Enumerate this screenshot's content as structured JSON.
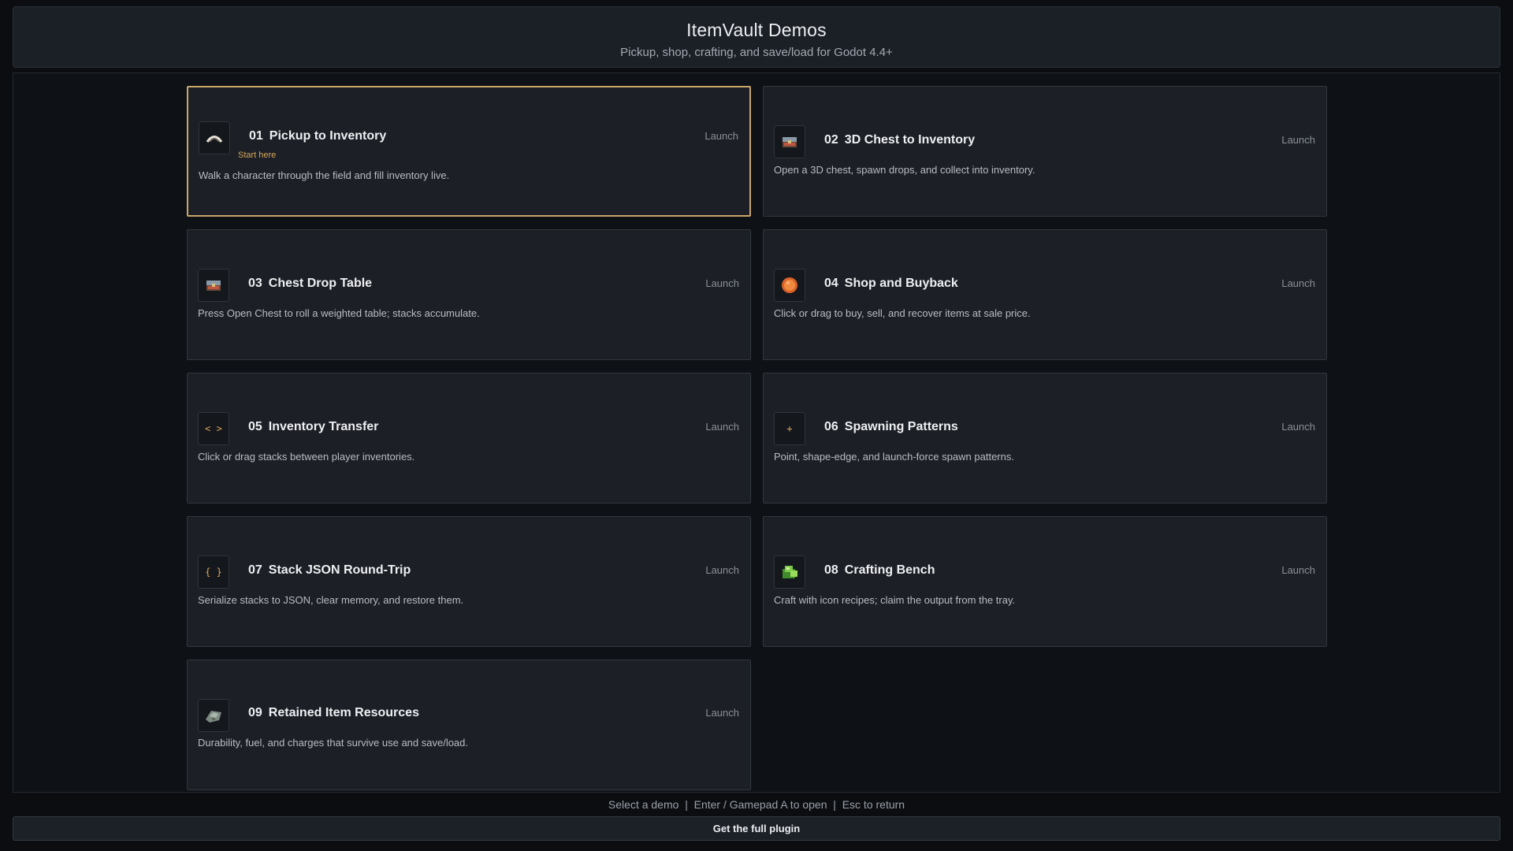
{
  "header": {
    "title": "ItemVault Demos",
    "subtitle": "Pickup, shop, crafting, and save/load for Godot 4.4+"
  },
  "demos": [
    {
      "num": "01",
      "title": "Pickup to Inventory",
      "launch": "Launch",
      "tag": "Start here",
      "desc": "Walk a character through the field and fill inventory live.",
      "icon": "arc-icon",
      "selected": true
    },
    {
      "num": "02",
      "title": "3D Chest to Inventory",
      "launch": "Launch",
      "desc": "Open a 3D chest, spawn drops, and collect into inventory.",
      "icon": "chest-icon"
    },
    {
      "num": "03",
      "title": "Chest Drop Table",
      "launch": "Launch",
      "desc": "Press Open Chest to roll a weighted table; stacks accumulate.",
      "icon": "chest-icon"
    },
    {
      "num": "04",
      "title": "Shop and Buyback",
      "launch": "Launch",
      "desc": "Click or drag to buy, sell, and recover items at sale price.",
      "icon": "coin-icon"
    },
    {
      "num": "05",
      "title": "Inventory Transfer",
      "launch": "Launch",
      "desc": "Click or drag stacks between player inventories.",
      "icon": "transfer-icon",
      "glyph": "< >"
    },
    {
      "num": "06",
      "title": "Spawning Patterns",
      "launch": "Launch",
      "desc": "Point, shape-edge, and launch-force spawn patterns.",
      "icon": "plus-icon",
      "glyph": "+"
    },
    {
      "num": "07",
      "title": "Stack JSON Round-Trip",
      "launch": "Launch",
      "desc": "Serialize stacks to JSON, clear memory, and restore them.",
      "icon": "braces-icon",
      "glyph": "{ }"
    },
    {
      "num": "08",
      "title": "Crafting Bench",
      "launch": "Launch",
      "desc": "Craft with icon recipes; claim the output from the tray.",
      "icon": "herb-icon"
    },
    {
      "num": "09",
      "title": "Retained Item Resources",
      "launch": "Launch",
      "desc": "Durability, fuel, and charges that survive use and save/load.",
      "icon": "ore-icon"
    }
  ],
  "hint": "Select a demo  |  Enter / Gamepad A to open  |  Esc to return",
  "footer": {
    "button_label": "Get the full plugin"
  },
  "colors": {
    "accent": "#c9a66a",
    "card_bg": "#1c1f25",
    "page_bg": "#0b0d11"
  }
}
